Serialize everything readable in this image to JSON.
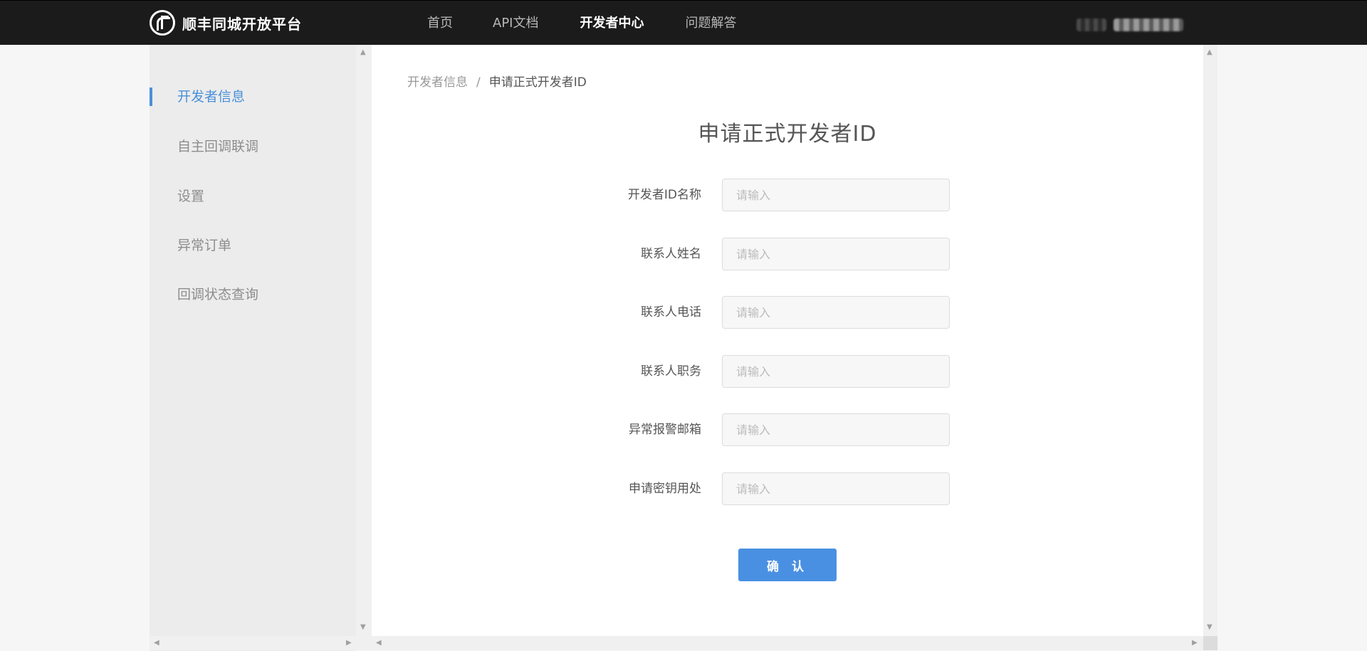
{
  "header": {
    "brand_name": "顺丰同城开放平台",
    "nav": [
      {
        "label": "首页",
        "active": false
      },
      {
        "label": "API文档",
        "active": false
      },
      {
        "label": "开发者中心",
        "active": true
      },
      {
        "label": "问题解答",
        "active": false
      }
    ]
  },
  "sidebar": {
    "items": [
      {
        "label": "开发者信息",
        "active": true
      },
      {
        "label": "自主回调联调",
        "active": false
      },
      {
        "label": "设置",
        "active": false
      },
      {
        "label": "异常订单",
        "active": false
      },
      {
        "label": "回调状态查询",
        "active": false
      }
    ]
  },
  "breadcrumb": {
    "parent": "开发者信息",
    "separator": "/",
    "current": "申请正式开发者ID"
  },
  "form": {
    "title": "申请正式开发者ID",
    "fields": [
      {
        "label": "开发者ID名称",
        "placeholder": "请输入",
        "value": ""
      },
      {
        "label": "联系人姓名",
        "placeholder": "请输入",
        "value": ""
      },
      {
        "label": "联系人电话",
        "placeholder": "请输入",
        "value": ""
      },
      {
        "label": "联系人职务",
        "placeholder": "请输入",
        "value": ""
      },
      {
        "label": "异常报警邮箱",
        "placeholder": "请输入",
        "value": ""
      },
      {
        "label": "申请密钥用处",
        "placeholder": "请输入",
        "value": ""
      }
    ],
    "submit_label": "确 认"
  },
  "colors": {
    "accent": "#4a90e2",
    "topbar": "#1b1b1b",
    "sidebar": "#ececec"
  },
  "icons": {
    "brand_logo": "sf-logo-icon",
    "scroll_up": "scroll-up-arrow-icon",
    "scroll_down": "scroll-down-arrow-icon",
    "scroll_left": "scroll-left-arrow-icon",
    "scroll_right": "scroll-right-arrow-icon"
  }
}
